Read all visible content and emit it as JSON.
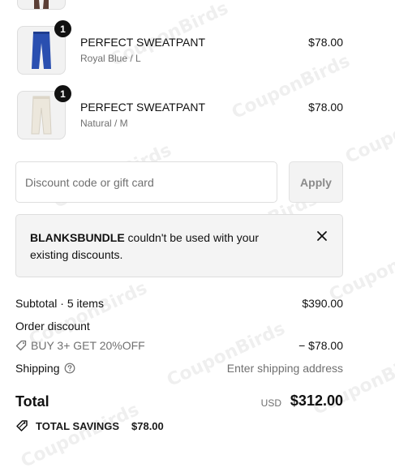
{
  "cart": {
    "items": [
      {
        "name": "PERFECT SWEATPANT",
        "variant": "Royal Blue / L",
        "price": "$78.00",
        "qty": "1",
        "color": "#2a4fb0"
      },
      {
        "name": "PERFECT SWEATPANT",
        "variant": "Natural / M",
        "price": "$78.00",
        "qty": "1",
        "color": "#ece7dc"
      }
    ]
  },
  "discount": {
    "placeholder": "Discount code or gift card",
    "apply_label": "Apply"
  },
  "notice": {
    "code": "BLANKSBUNDLE",
    "message": " couldn't be used with your existing discounts."
  },
  "summary": {
    "subtotal_label": "Subtotal · 5 items",
    "subtotal_value": "$390.00",
    "order_discount_label": "Order discount",
    "discount_code": "BUY 3+ GET 20%OFF",
    "discount_value": "− $78.00",
    "shipping_label": "Shipping",
    "shipping_value": "Enter shipping address",
    "total_label": "Total",
    "currency": "USD",
    "total_value": "$312.00",
    "savings_label": "TOTAL SAVINGS",
    "savings_value": "$78.00"
  },
  "watermark": "CouponBirds"
}
